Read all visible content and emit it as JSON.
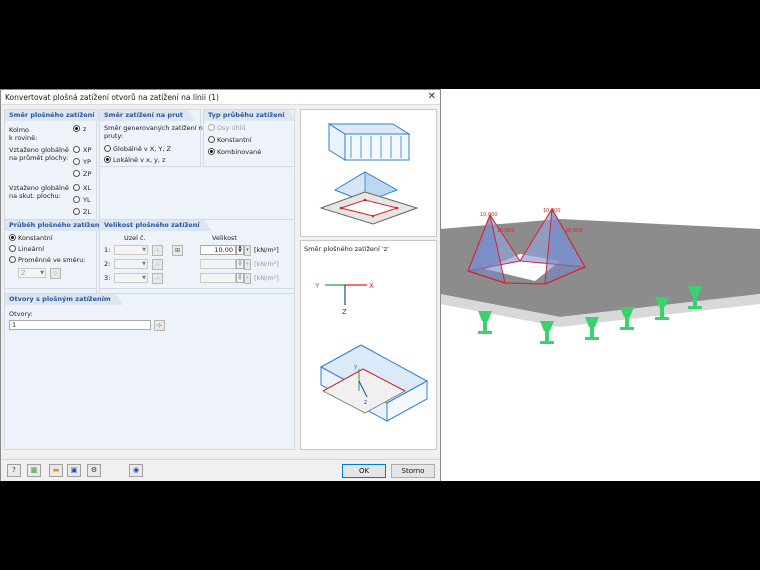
{
  "dialog": {
    "title": "Konvertovat plošná zatížení otvorů na zatížení na linii   (1)",
    "close_glyph": "✕"
  },
  "surface_direction": {
    "header": "Směr plošného zatížení",
    "perpendicular_label": "Kolmo\nk rovině:",
    "opt_z": "z",
    "global_projected_label": "Vztaženo globálně\nna průmět plochy:",
    "opt_xp": "XP",
    "opt_yp": "YP",
    "opt_zp": "ZP",
    "global_true_label": "Vztaženo globálně\nna skut. plochu:",
    "opt_xl": "XL",
    "opt_yl": "YL",
    "opt_zl": "ZL"
  },
  "member_direction": {
    "header": "Směr zatížení na prut",
    "description": "Směr generovaných zatížení na\npruty:",
    "opt_global": "Globálně v X, Y, Z",
    "opt_local": "Lokálně v x, y, z"
  },
  "load_type": {
    "header": "Typ průběhu zatížení",
    "opt_axis_angle": "Osy úhlů",
    "opt_constant": "Konstantní",
    "opt_combined": "Kombinované"
  },
  "surface_load_course": {
    "header": "Průběh plošného zatížení",
    "opt_constant": "Konstantní",
    "opt_linear": "Lineární",
    "opt_variable": "Proměnné ve směru:",
    "direction_value": "Z"
  },
  "surface_load_magnitude": {
    "header": "Velikost plošného zatížení",
    "node_header": "Uzel č.",
    "magnitude_header": "Velikost",
    "row1_label": "1:",
    "row2_label": "2:",
    "row3_label": "3:",
    "row1_value": "10.00",
    "unit": "[kN/m²]"
  },
  "openings": {
    "header": "Otvory s plošným zatížením",
    "label": "Otvory:",
    "value": "1"
  },
  "preview": {
    "caption": "Směr plošného zatížení 'z'"
  },
  "buttons": {
    "ok": "OK",
    "cancel": "Storno"
  },
  "model_view": {
    "load_label_1": "10.000",
    "load_label_2": "10.000",
    "load_label_3": "10.000",
    "load_label_4": "10.000"
  },
  "colors": {
    "accent_header": "#2b5797",
    "load_red": "#d9222a",
    "load_fill": "#8fa3d8",
    "support_green": "#3bd16f",
    "slab": "#8c8c8c"
  }
}
